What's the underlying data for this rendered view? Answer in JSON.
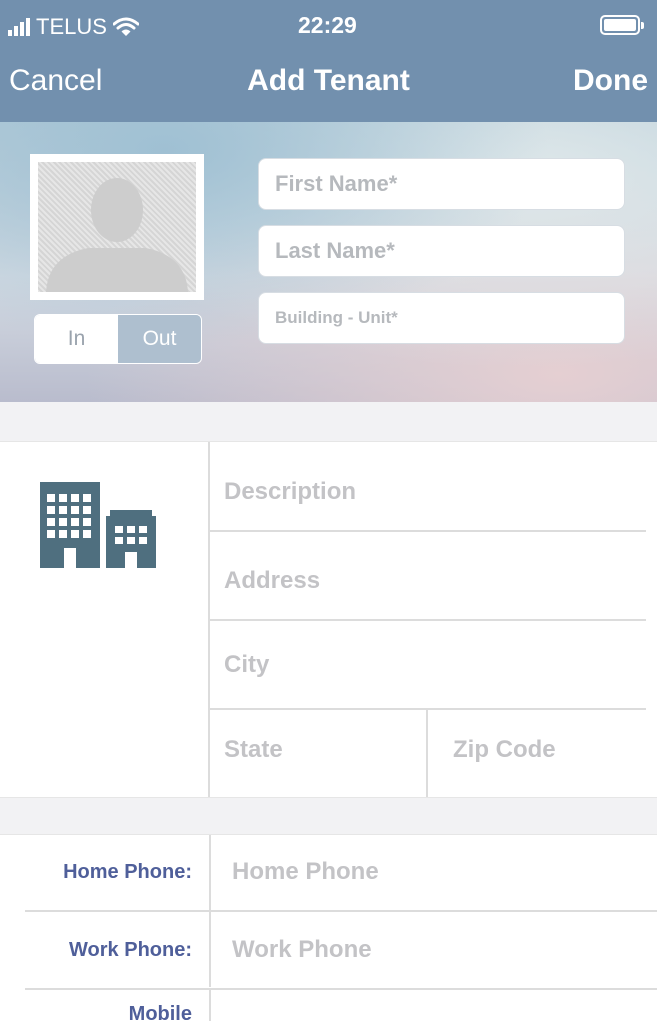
{
  "status_bar": {
    "carrier": "TELUS",
    "time": "22:29"
  },
  "nav": {
    "cancel_label": "Cancel",
    "title": "Add Tenant",
    "done_label": "Done"
  },
  "header": {
    "in_label": "In",
    "out_label": "Out",
    "first_name_placeholder": "First Name*",
    "last_name_placeholder": "Last Name*",
    "building_unit_placeholder": "Building - Unit*"
  },
  "address": {
    "description_placeholder": "Description",
    "address_placeholder": "Address",
    "city_placeholder": "City",
    "state_placeholder": "State",
    "zip_placeholder": "Zip Code"
  },
  "phones": {
    "home_label": "Home Phone:",
    "home_placeholder": "Home Phone",
    "work_label": "Work Phone:",
    "work_placeholder": "Work Phone",
    "mobile_label": "Mobile"
  },
  "colors": {
    "nav_bar": "#7290ae",
    "label_blue": "#4f5f9a",
    "building_icon": "#4f6f7f"
  }
}
